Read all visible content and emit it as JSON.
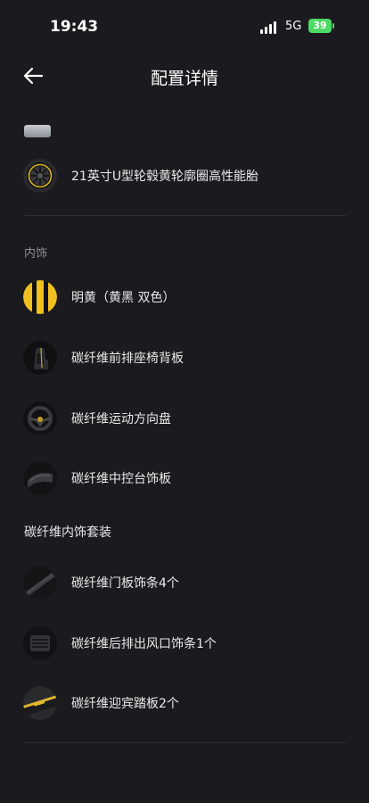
{
  "status": {
    "time": "19:43",
    "network": "5G",
    "battery": "39"
  },
  "nav": {
    "title": "配置详情"
  },
  "wheels": {
    "item": "21英寸U型轮毂黄轮廓圈高性能胎"
  },
  "interior": {
    "section_label": "内饰",
    "items": [
      "明黄（黄黑 双色）",
      "碳纤维前排座椅背板",
      "碳纤维运动方向盘",
      "碳纤维中控台饰板"
    ]
  },
  "carbon_package": {
    "label": "碳纤维内饰套装",
    "items": [
      "碳纤维门板饰条4个",
      "碳纤维后排出风口饰条1个",
      "碳纤维迎宾踏板2个"
    ]
  },
  "colors": {
    "background": "#1b1b1f",
    "accent_yellow": "#f0c020",
    "divider": "#2e2e33"
  }
}
